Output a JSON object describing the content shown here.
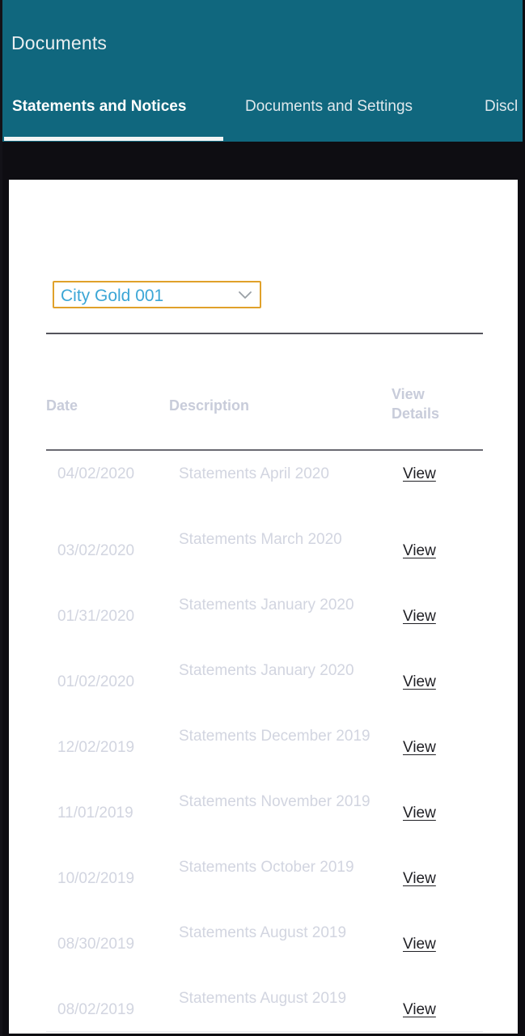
{
  "header": {
    "title": "Documents",
    "background_color": "#10677e",
    "tabs": [
      {
        "label": "Statements and Notices",
        "active": true
      },
      {
        "label": "Documents and Settings",
        "active": false
      },
      {
        "label": "Discl",
        "active": false
      }
    ]
  },
  "account_selector": {
    "name": "account-dropdown",
    "selected_value": "City Gold 001",
    "chevron_icon": "chevron-down-icon",
    "border_color": "#e0a12a",
    "text_color": "#3ba6d6"
  },
  "documents_table": {
    "columns": [
      "Date",
      "Description",
      "View Details"
    ],
    "view_details_line1": "View",
    "view_details_line2": "Details",
    "rows": [
      {
        "date": "04/02/2020",
        "description": "Statements April 2020",
        "action": "View",
        "lines": 1
      },
      {
        "date": "03/02/2020",
        "description": "Statements March 2020",
        "action": "View",
        "lines": 2
      },
      {
        "date": "01/31/2020",
        "description": "Statements January 2020",
        "action": "View",
        "lines": 2
      },
      {
        "date": "01/02/2020",
        "description": "Statements January 2020",
        "action": "View",
        "lines": 2
      },
      {
        "date": "12/02/2019",
        "description": "Statements December 2019",
        "action": "View",
        "lines": 2
      },
      {
        "date": "11/01/2019",
        "description": "Statements November 2019",
        "action": "View",
        "lines": 2
      },
      {
        "date": "10/02/2019",
        "description": "Statements October 2019",
        "action": "View",
        "lines": 2
      },
      {
        "date": "08/30/2019",
        "description": "Statements August 2019",
        "action": "View",
        "lines": 2
      },
      {
        "date": "08/02/2019",
        "description": "Statements August 2019",
        "action": "View",
        "lines": 2
      }
    ]
  },
  "colors": {
    "header_teal": "#10677e",
    "page_dark": "#0d0c11",
    "card_white": "#ffffff",
    "muted_text": "#d2d5e0",
    "header_text": "#c8ccda",
    "link_text": "#1f1f24",
    "accent_orange": "#e0a12a",
    "accent_blue": "#3ba6d6"
  }
}
